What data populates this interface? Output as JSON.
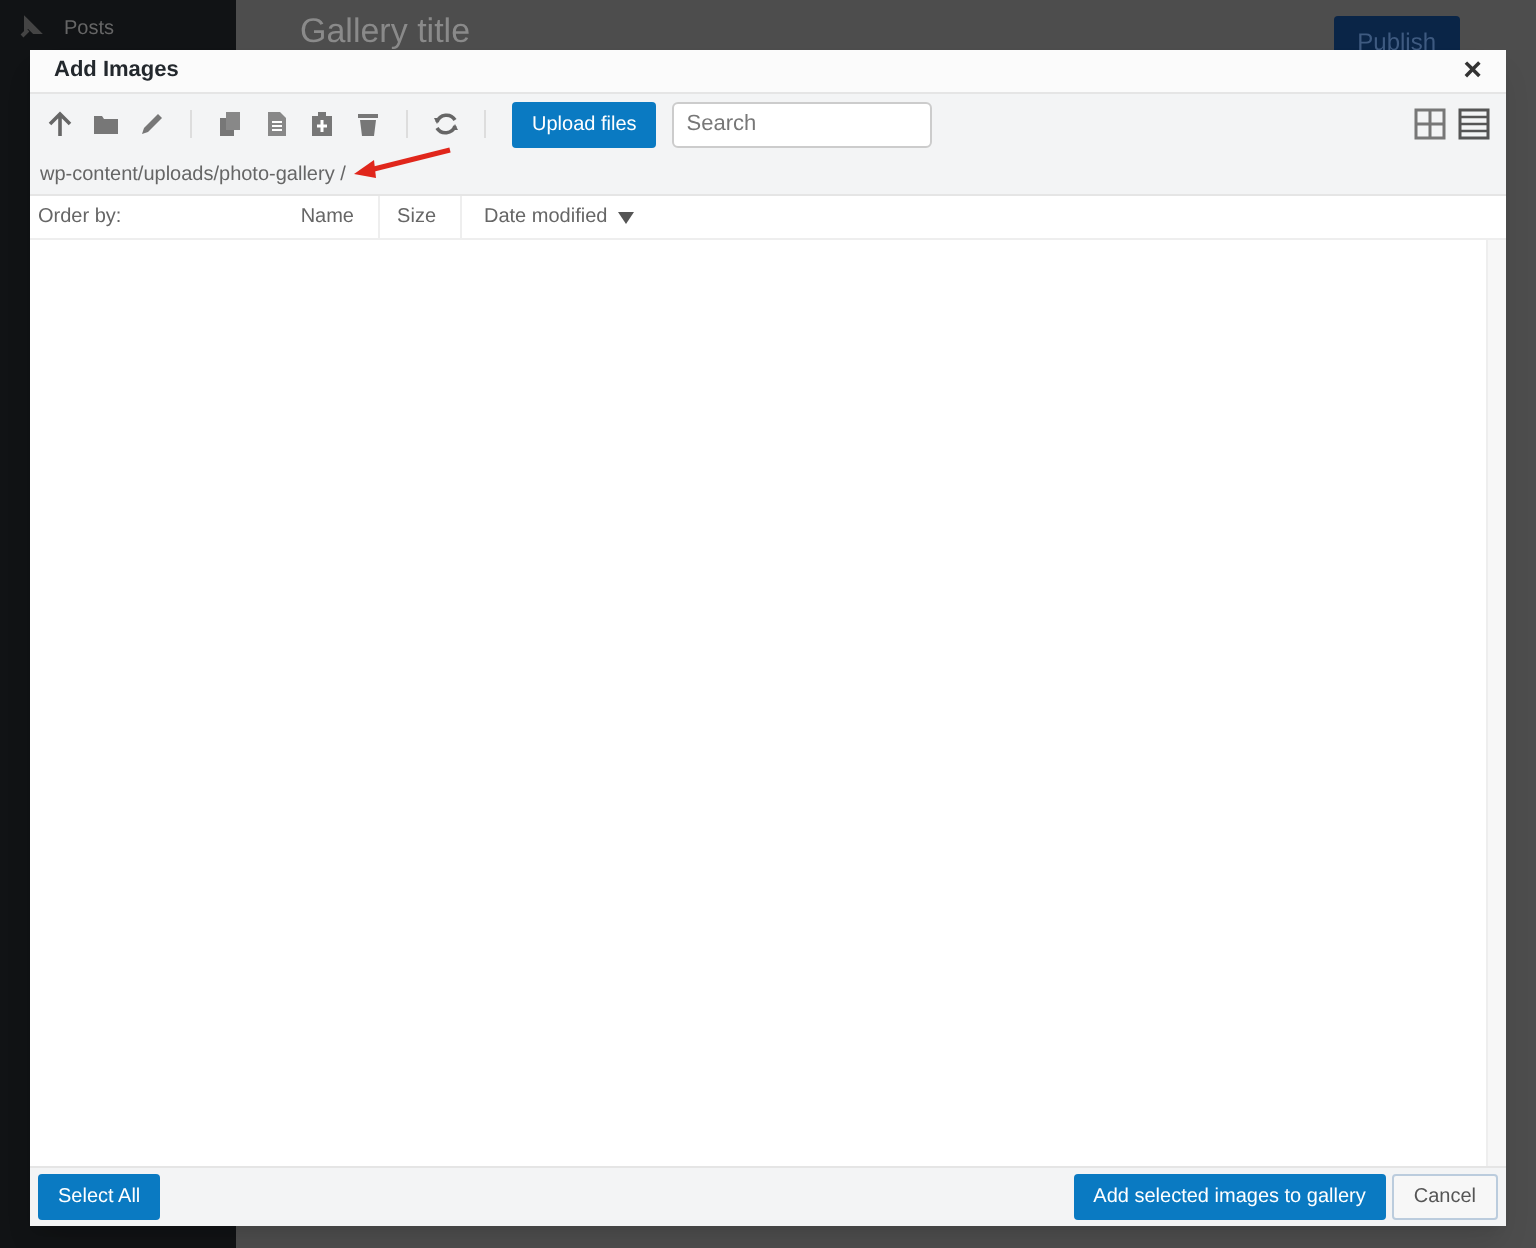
{
  "background": {
    "sidebar_items": [
      "Posts"
    ],
    "page_title": "Gallery title",
    "publish_button": "Publish"
  },
  "dialog": {
    "title": "Add Images",
    "close": "×",
    "toolbar": {
      "tools": [
        {
          "kind": "up"
        },
        {
          "kind": "folder"
        },
        {
          "kind": "edit"
        },
        {
          "kind": "sep"
        },
        {
          "kind": "copy"
        },
        {
          "kind": "document"
        },
        {
          "kind": "paste"
        },
        {
          "kind": "trash"
        },
        {
          "kind": "sep"
        },
        {
          "kind": "refresh"
        },
        {
          "kind": "sep"
        }
      ],
      "upload_button": "Upload files",
      "search": {
        "placeholder": "Search"
      },
      "views": [
        {
          "kind": "grid",
          "selected": false
        },
        {
          "kind": "list",
          "selected": true
        }
      ]
    },
    "path": "wp-content/uploads/photo-gallery /",
    "columns": [
      {
        "label": "Order by:"
      },
      {
        "label": "Name"
      },
      {
        "label": "Size"
      },
      {
        "label": "Date modified",
        "sort_descending": true
      }
    ],
    "footer": {
      "select_all": "Select All",
      "add_button": "Add selected images to gallery",
      "cancel_button": "Cancel"
    }
  }
}
